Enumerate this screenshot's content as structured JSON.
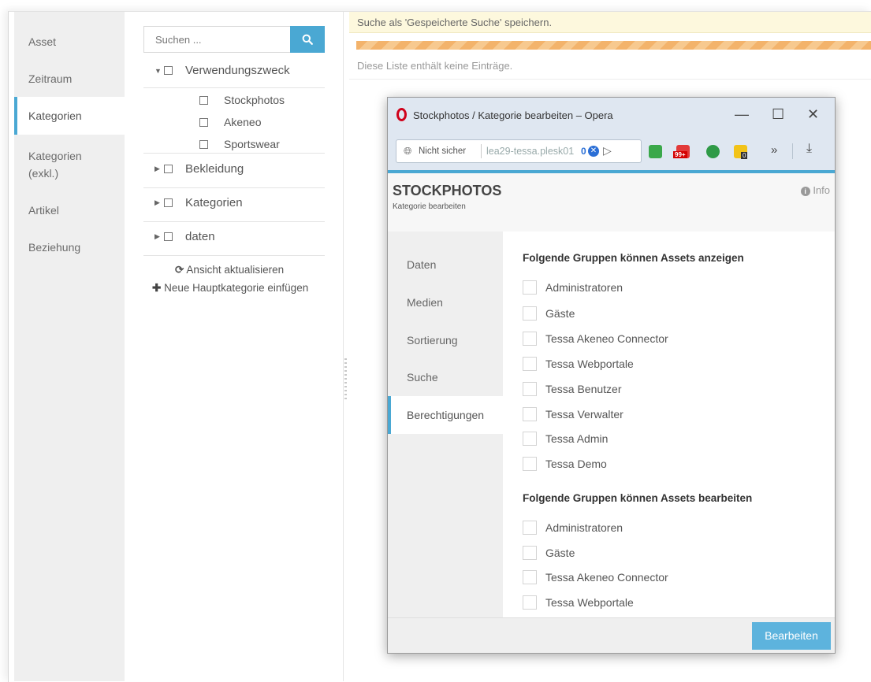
{
  "leftnav": {
    "items": [
      {
        "label": "Asset"
      },
      {
        "label": "Zeitraum"
      },
      {
        "label": "Kategorien"
      },
      {
        "label": "Kategorien (exkl.)"
      },
      {
        "label": "Artikel"
      },
      {
        "label": "Beziehung"
      }
    ],
    "active_index": 2
  },
  "tree": {
    "search_placeholder": "Suchen ...",
    "nodes": [
      {
        "label": "Verwendungszweck",
        "expanded": true,
        "children": [
          "Stockphotos",
          "Akeneo",
          "Sportswear"
        ]
      },
      {
        "label": "Bekleidung",
        "expanded": false
      },
      {
        "label": "Kategorien",
        "expanded": false
      },
      {
        "label": "daten",
        "expanded": false
      }
    ],
    "refresh_label": "Ansicht aktualisieren",
    "add_root_label": "Neue Hauptkategorie einfügen"
  },
  "main": {
    "banner_text": "Suche als 'Gespeicherte Suche' speichern.",
    "empty_text": "Diese Liste enthält keine Einträge."
  },
  "popup": {
    "window_title": "Stockphotos / Kategorie bearbeiten – Opera",
    "address": {
      "security_label": "Nicht sicher",
      "url": "lea29-tessa.plesk01",
      "badge_count": "0",
      "mail_badge": "99+",
      "folder_badge": "0"
    },
    "title": "STOCKPHOTOS",
    "subtitle": "Kategorie bearbeiten",
    "info_label": "Info",
    "tabs": [
      "Daten",
      "Medien",
      "Sortierung",
      "Suche",
      "Berechtigungen"
    ],
    "active_tab": 4,
    "sections": [
      {
        "title": "Folgende Gruppen können Assets anzeigen",
        "groups": [
          "Administratoren",
          "Gäste",
          "Tessa Akeneo Connector",
          "Tessa Webportale",
          "Tessa Benutzer",
          "Tessa Verwalter",
          "Tessa Admin",
          "Tessa Demo"
        ]
      },
      {
        "title": "Folgende Gruppen können Assets bearbeiten",
        "groups": [
          "Administratoren",
          "Gäste",
          "Tessa Akeneo Connector",
          "Tessa Webportale"
        ]
      }
    ],
    "footer_button": "Bearbeiten"
  },
  "colors": {
    "accent": "#4aa8d3",
    "banner_bg": "#fdf8dd",
    "progress": "#f3b36b",
    "button": "#5db3dd"
  }
}
